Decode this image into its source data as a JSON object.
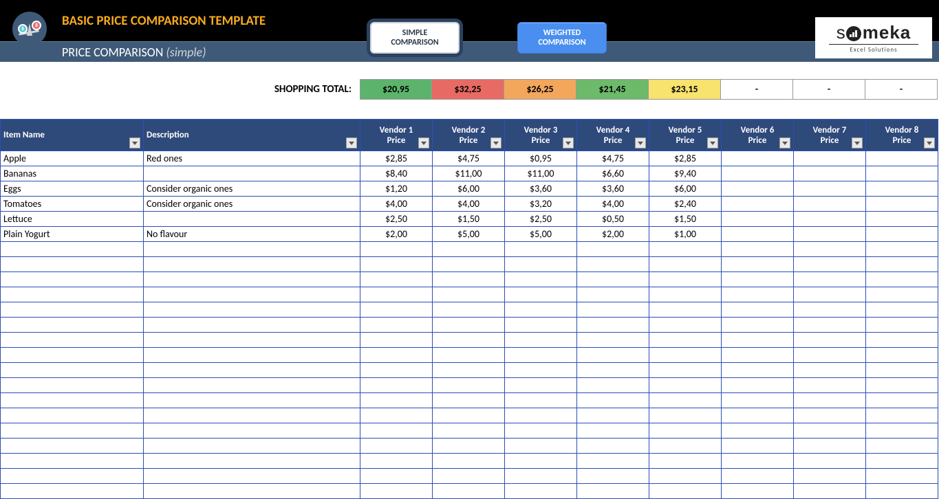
{
  "header": {
    "title_top": "BASIC PRICE COMPARISON TEMPLATE",
    "title_sub_main": "PRICE COMPARISON",
    "title_sub_paren": "(simple)",
    "btn_simple_l1": "SIMPLE",
    "btn_simple_l2": "COMPARISON",
    "btn_weighted_l1": "WEIGHTED",
    "btn_weighted_l2": "COMPARISON",
    "brand_name_thin": "s",
    "brand_name_rest": "meka",
    "brand_tag": "Excel Solutions"
  },
  "totals": {
    "label": "SHOPPING TOTAL:",
    "cells": [
      {
        "value": "$20,95",
        "bg": "#5cb46c"
      },
      {
        "value": "$32,25",
        "bg": "#e86a64"
      },
      {
        "value": "$26,25",
        "bg": "#f2a75c"
      },
      {
        "value": "$21,45",
        "bg": "#6cba6a"
      },
      {
        "value": "$23,15",
        "bg": "#f7e36d"
      },
      {
        "value": "-",
        "bg": "#ffffff"
      },
      {
        "value": "-",
        "bg": "#ffffff"
      },
      {
        "value": "-",
        "bg": "#ffffff"
      }
    ]
  },
  "table": {
    "headers": {
      "item": "Item Name",
      "desc": "Description",
      "vendors": [
        {
          "l1": "Vendor 1",
          "l2": "Price"
        },
        {
          "l1": "Vendor 2",
          "l2": "Price"
        },
        {
          "l1": "Vendor 3",
          "l2": "Price"
        },
        {
          "l1": "Vendor 4",
          "l2": "Price"
        },
        {
          "l1": "Vendor 5",
          "l2": "Price"
        },
        {
          "l1": "Vendor 6",
          "l2": "Price"
        },
        {
          "l1": "Vendor 7",
          "l2": "Price"
        },
        {
          "l1": "Vendor 8",
          "l2": "Price"
        }
      ]
    },
    "rows": [
      {
        "item": "Apple",
        "desc": "Red ones",
        "v": [
          "$2,85",
          "$4,75",
          "$0,95",
          "$4,75",
          "$2,85",
          "",
          "",
          ""
        ]
      },
      {
        "item": "Bananas",
        "desc": "",
        "v": [
          "$8,40",
          "$11,00",
          "$11,00",
          "$6,60",
          "$9,40",
          "",
          "",
          ""
        ]
      },
      {
        "item": "Eggs",
        "desc": "Consider organic ones",
        "v": [
          "$1,20",
          "$6,00",
          "$3,60",
          "$3,60",
          "$6,00",
          "",
          "",
          ""
        ]
      },
      {
        "item": "Tomatoes",
        "desc": "Consider organic ones",
        "v": [
          "$4,00",
          "$4,00",
          "$3,20",
          "$4,00",
          "$2,40",
          "",
          "",
          ""
        ]
      },
      {
        "item": "Lettuce",
        "desc": "",
        "v": [
          "$2,50",
          "$1,50",
          "$2,50",
          "$0,50",
          "$1,50",
          "",
          "",
          ""
        ]
      },
      {
        "item": "Plain Yogurt",
        "desc": "No flavour",
        "v": [
          "$2,00",
          "$5,00",
          "$5,00",
          "$2,00",
          "$1,00",
          "",
          "",
          ""
        ]
      }
    ],
    "empty_rows": 17
  }
}
